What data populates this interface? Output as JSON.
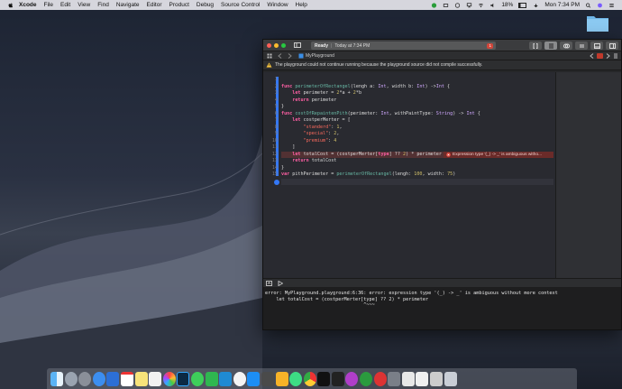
{
  "menubar": {
    "app_name": "Xcode",
    "menus": [
      "File",
      "Edit",
      "View",
      "Find",
      "Navigate",
      "Editor",
      "Product",
      "Debug",
      "Source Control",
      "Window",
      "Help"
    ],
    "battery": "18%",
    "clock": "Mon 7:34 PM"
  },
  "window": {
    "status_state": "Ready",
    "status_time": "Today at 7:34 PM",
    "error_count": "1",
    "breadcrumb": "MyPlayground",
    "warning_message": "The playground could not continue running because the playground source did not compile successfully."
  },
  "code_lines": [
    {
      "n": "1",
      "text": ""
    },
    {
      "n": "2",
      "text": "func perimeterOfRectangel(lengh a: Int, width b: Int) ->Int {"
    },
    {
      "n": "3",
      "text": "    let perimeter = 2*a + 2*b"
    },
    {
      "n": "4",
      "text": "    return perimeter"
    },
    {
      "n": "5",
      "text": "}"
    },
    {
      "n": "6",
      "text": "func costOfRepaintenPith(perimeter: Int, withPaintType: String) -> Int {"
    },
    {
      "n": "7",
      "text": "    let costperMerter = ["
    },
    {
      "n": "8",
      "text": "        \"standerd\": 1,"
    },
    {
      "n": "9",
      "text": "        \"special\": 2,"
    },
    {
      "n": "10",
      "text": "        \"premium\": 4"
    },
    {
      "n": "11",
      "text": "    ]"
    },
    {
      "n": "12",
      "text": "    let totalCost = (costperMerter[type] ?? 2) * perimeter"
    },
    {
      "n": "13",
      "text": "    return totalCost"
    },
    {
      "n": "14",
      "text": "}"
    },
    {
      "n": "15",
      "text": "var pithPerimeter = perimeterOfRectangel(lengh: 100, width: 75)"
    },
    {
      "n": "16",
      "text": ""
    }
  ],
  "inline_error": "Expression type '(_) -> _' is ambiguous witho...",
  "console_lines": [
    "error: MyPlayground.playground:6:36: error: expression type '(_) -> _' is ambiguous without more context",
    "    let totalCost = (costperMerter[type] ?? 2) * perimeter",
    "                                   ^~~~"
  ],
  "colors": {
    "accent": "#3478f6",
    "error": "#d0463a",
    "keyword": "#fc5fa3",
    "string": "#fc6a5d",
    "number": "#d0bf69"
  },
  "dock_apps": [
    "finder-icon",
    "launchpad-icon",
    "compass-icon",
    "safari-icon",
    "xcode-icon",
    "calendar-icon",
    "notes-icon",
    "reminders-icon",
    "photos-icon",
    "photoshop-icon",
    "messages-icon",
    "facetime-icon",
    "vscode-icon",
    "music-icon",
    "appstore-icon",
    "sublime-icon",
    "sketch-icon",
    "android-studio-icon",
    "chrome-icon",
    "intellij-icon",
    "terminal-icon",
    "cr-icon",
    "torrent-icon",
    "scrivener-icon",
    "preferences-icon",
    "trash-icon"
  ]
}
